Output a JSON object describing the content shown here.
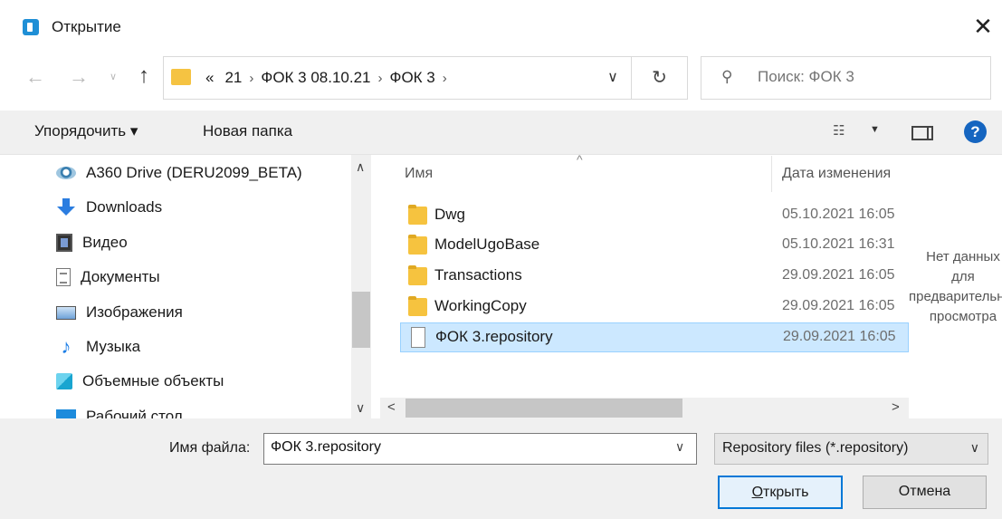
{
  "window": {
    "title": "Открытие",
    "close_glyph": "✕"
  },
  "nav": {
    "back_glyph": "←",
    "forward_glyph": "→",
    "recent_glyph": "∨",
    "up_glyph": "↑",
    "address": {
      "overflow": "«",
      "crumbs": [
        "21",
        "ФОК 3 08.10.21",
        "ФОК 3"
      ],
      "separator": "›",
      "dropdown_glyph": "∨"
    },
    "refresh_glyph": "↻",
    "search": {
      "placeholder": "Поиск: ФОК 3",
      "icon_glyph": "⚲"
    }
  },
  "toolbar": {
    "organize": "Упорядочить ▾",
    "new_folder": "Новая папка",
    "view_glyph": "☷",
    "view_caret": "▼",
    "help_glyph": "?"
  },
  "sidebar": {
    "items": [
      {
        "label": "A360 Drive (DERU2099_BETA)",
        "icon": "a360-drive-icon"
      },
      {
        "label": "Downloads",
        "icon": "downloads-icon"
      },
      {
        "label": "Видео",
        "icon": "video-icon"
      },
      {
        "label": "Документы",
        "icon": "documents-icon"
      },
      {
        "label": "Изображения",
        "icon": "images-icon"
      },
      {
        "label": "Музыка",
        "icon": "music-icon"
      },
      {
        "label": "Объемные объекты",
        "icon": "3d-objects-icon"
      },
      {
        "label": "Рабочий стол",
        "icon": "desktop-icon"
      }
    ],
    "scroll_up": "∧",
    "scroll_down": "∨"
  },
  "files": {
    "columns": {
      "name": "Имя",
      "date": "Дата изменения",
      "sort_glyph": "^"
    },
    "rows": [
      {
        "name": "Dwg",
        "date": "05.10.2021 16:05",
        "type": "folder",
        "selected": false
      },
      {
        "name": "ModelUgoBase",
        "date": "05.10.2021 16:31",
        "type": "folder",
        "selected": false
      },
      {
        "name": "Transactions",
        "date": "29.09.2021 16:05",
        "type": "folder",
        "selected": false
      },
      {
        "name": "WorkingCopy",
        "date": "29.09.2021 16:05",
        "type": "folder",
        "selected": false
      },
      {
        "name": "ФОК 3.repository",
        "date": "29.09.2021 16:05",
        "type": "file",
        "selected": true
      }
    ],
    "hscroll_left": "<",
    "hscroll_right": ">"
  },
  "preview": {
    "text": "Нет данных\nдля\nпредварительного\nпросмотра"
  },
  "footer": {
    "filename_label": "Имя файла:",
    "filename_value": "ФОК 3.repository",
    "filename_dropdown": "∨",
    "filetype": "Repository files (*.repository)",
    "filetype_caret": "∨",
    "open_first": "О",
    "open_rest": "ткрыть",
    "cancel": "Отмена"
  },
  "colors": {
    "selection_bg": "#cce8ff",
    "accent": "#0078d7",
    "folder": "#f6c33f"
  }
}
